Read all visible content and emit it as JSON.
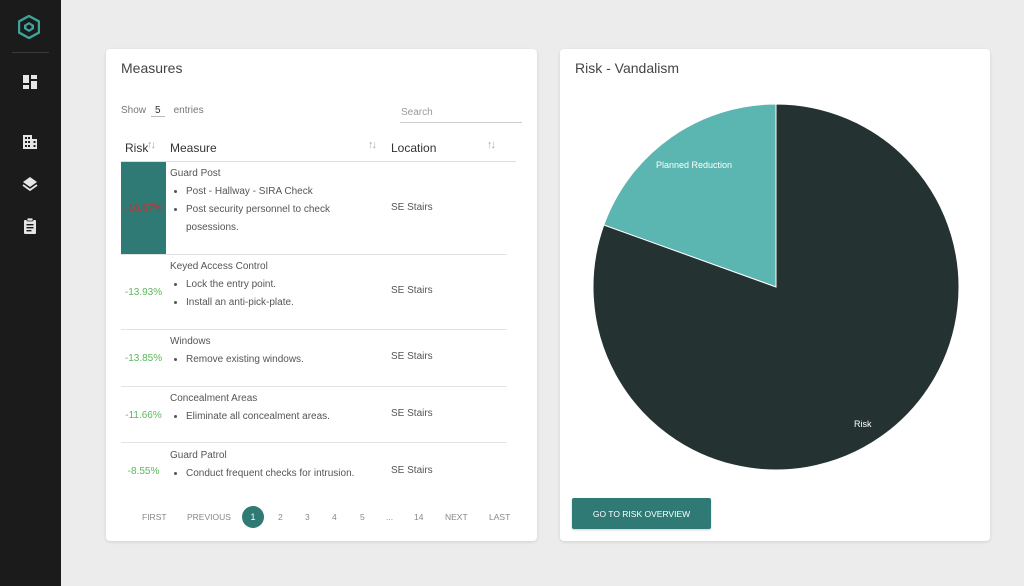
{
  "colors": {
    "sidebar_bg": "#1b1b1b",
    "accent": "#2f7a75",
    "planned_reduction": "#5bb5b1",
    "risk_dark": "#243232",
    "positive": "#5cb85c",
    "highlight_text": "#c9302c"
  },
  "sidebar": {
    "logo_icon": "hexagon-logo-icon",
    "items": [
      {
        "icon": "dashboard-icon"
      },
      {
        "icon": "building-icon"
      },
      {
        "icon": "layers-icon"
      },
      {
        "icon": "clipboard-icon"
      }
    ]
  },
  "measures": {
    "title": "Measures",
    "show_label": "Show",
    "show_value": "5",
    "entries_label": "entries",
    "search_placeholder": "Search",
    "columns": [
      "Risk",
      "Measure",
      "Location"
    ],
    "sort_glyph": "↑↓",
    "rows": [
      {
        "risk": "-18.67%",
        "title": "Guard Post",
        "items": [
          "Post - Hallway - SIRA Check",
          "Post security personnel to check posessions."
        ],
        "location": "SE Stairs"
      },
      {
        "risk": "-13.93%",
        "title": "Keyed Access Control",
        "items": [
          "Lock the entry point.",
          "Install an anti-pick-plate."
        ],
        "location": "SE Stairs"
      },
      {
        "risk": "-13.85%",
        "title": "Windows",
        "items": [
          "Remove existing windows."
        ],
        "location": "SE Stairs"
      },
      {
        "risk": "-11.66%",
        "title": "Concealment Areas",
        "items": [
          "Eliminate all concealment areas."
        ],
        "location": "SE Stairs"
      },
      {
        "risk": "-8.55%",
        "title": "Guard Patrol",
        "items": [
          "Conduct frequent checks for intrusion."
        ],
        "location": "SE Stairs"
      }
    ],
    "pagination": {
      "first": "FIRST",
      "previous": "PREVIOUS",
      "pages": [
        "1",
        "2",
        "3",
        "4",
        "5",
        "...",
        "14"
      ],
      "current": "1",
      "next": "NEXT",
      "last": "LAST"
    }
  },
  "risk_panel": {
    "title": "Risk - Vandalism",
    "button_label": "GO TO RISK OVERVIEW"
  },
  "chart_data": {
    "type": "pie",
    "title": "",
    "slices": [
      {
        "label": "Planned Reduction",
        "value": 19.5,
        "color": "#5bb5b1"
      },
      {
        "label": "Risk",
        "value": 80.5,
        "color": "#243232"
      }
    ]
  }
}
